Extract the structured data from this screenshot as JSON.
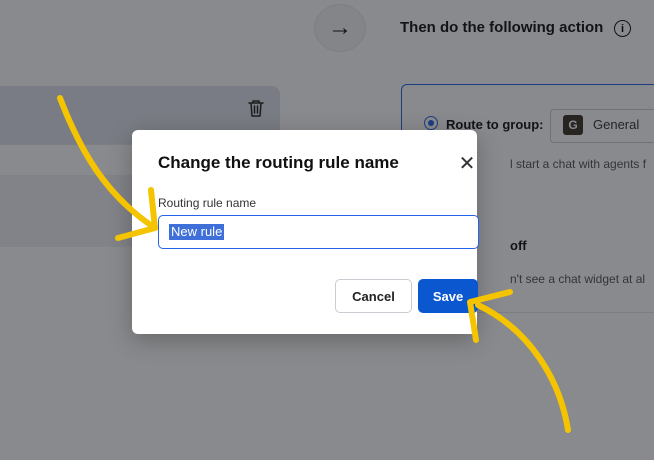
{
  "background": {
    "header": {
      "then_label": "Then do the following action",
      "arrow_glyph": "→",
      "info_glyph": "i"
    },
    "route": {
      "label": "Route to group:",
      "group_initial": "G",
      "group_name": "General",
      "description": "l start a chat with agents f"
    },
    "off": {
      "label": "off",
      "description": "n't see a chat widget at al"
    }
  },
  "modal": {
    "title": "Change the routing rule name",
    "close_glyph": "✕",
    "field_label": "Routing rule name",
    "field_value": "New rule",
    "cancel_label": "Cancel",
    "save_label": "Save"
  },
  "colors": {
    "accent": "#0b57d0",
    "annotation_arrow": "#f5c400",
    "overlay": "rgba(20,22,28,0.5)"
  },
  "icons": [
    "trash-icon",
    "arrow-right-icon",
    "info-icon",
    "close-icon"
  ]
}
